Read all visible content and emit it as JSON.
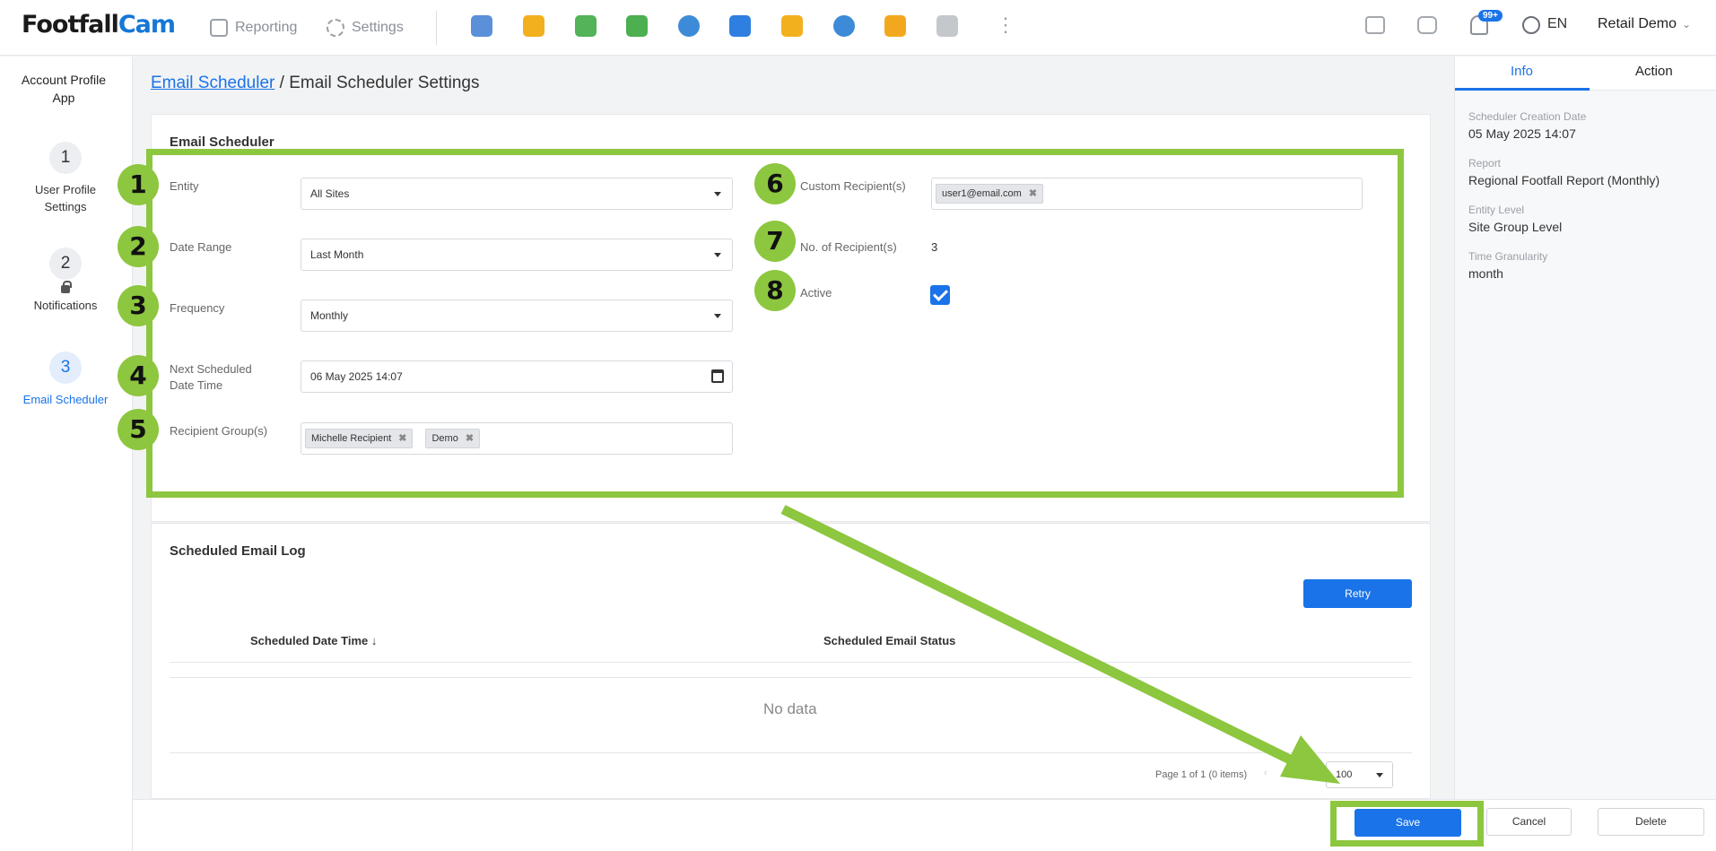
{
  "brand": {
    "logo_main": "Footfall",
    "logo_accent": "Cam"
  },
  "topnav": {
    "reporting": "Reporting",
    "settings": "Settings",
    "apps": [
      {
        "icon": "store-icon",
        "color": "#5b8fd9"
      },
      {
        "icon": "chart-icon",
        "color": "#f2b01e"
      },
      {
        "icon": "calendar-icon",
        "color": "#52b358"
      },
      {
        "icon": "sales-icon",
        "color": "#4caf50"
      },
      {
        "icon": "weather-icon",
        "color": "#3d8bd8"
      },
      {
        "icon": "home-icon",
        "color": "#2f7fe0"
      },
      {
        "icon": "document-alert-icon",
        "color": "#f2b01e"
      },
      {
        "icon": "database-icon",
        "color": "#3d8bd8"
      },
      {
        "icon": "zone-icon",
        "color": "#f2a81e"
      },
      {
        "icon": "server-icon",
        "color": "#9aa0a6"
      }
    ],
    "badge": "99+",
    "language": "EN",
    "user": "Retail Demo",
    "accent_color": "#1a73e8",
    "highlight_color": "#8dc63f"
  },
  "leftnav": {
    "app_title": "Account Profile App",
    "steps": [
      {
        "num": "1",
        "label": "User Profile Settings"
      },
      {
        "num": "2",
        "label": "Notifications"
      },
      {
        "num": "3",
        "label": "Email Scheduler"
      }
    ]
  },
  "breadcrumb": {
    "link": "Email Scheduler",
    "sep": "/",
    "current": "Email Scheduler Settings"
  },
  "form": {
    "title": "Email Scheduler",
    "entity_label": "Entity",
    "entity_value": "All Sites",
    "date_range_label": "Date Range",
    "date_range_value": "Last Month",
    "frequency_label": "Frequency",
    "frequency_value": "Monthly",
    "next_label_1": "Next Scheduled",
    "next_label_2": "Date Time",
    "next_value": "06 May 2025 14:07",
    "recipient_groups_label": "Recipient Group(s)",
    "recipient_groups": [
      "Michelle Recipient",
      "Demo"
    ],
    "custom_label": "Custom Recipient(s)",
    "custom_recipients": [
      "user1@email.com"
    ],
    "count_label": "No. of Recipient(s)",
    "count_value": "3",
    "active_label": "Active",
    "active": true
  },
  "markers": [
    "1",
    "2",
    "3",
    "4",
    "5",
    "6",
    "7",
    "8"
  ],
  "log": {
    "title": "Scheduled Email Log",
    "retry": "Retry",
    "col1": "Scheduled Date Time ↓",
    "col2": "Scheduled Email Status",
    "empty": "No data",
    "pager": "Page 1 of 1 (0 items)",
    "page_size": "100"
  },
  "info": {
    "tab_info": "Info",
    "tab_action": "Action",
    "created_label": "Scheduler Creation Date",
    "created_value": "05 May 2025 14:07",
    "report_label": "Report",
    "report_value": "Regional Footfall Report (Monthly)",
    "entity_label": "Entity Level",
    "entity_value": "Site Group Level",
    "gran_label": "Time Granularity",
    "gran_value": "month"
  },
  "footer": {
    "save": "Save",
    "cancel": "Cancel",
    "delete": "Delete"
  }
}
